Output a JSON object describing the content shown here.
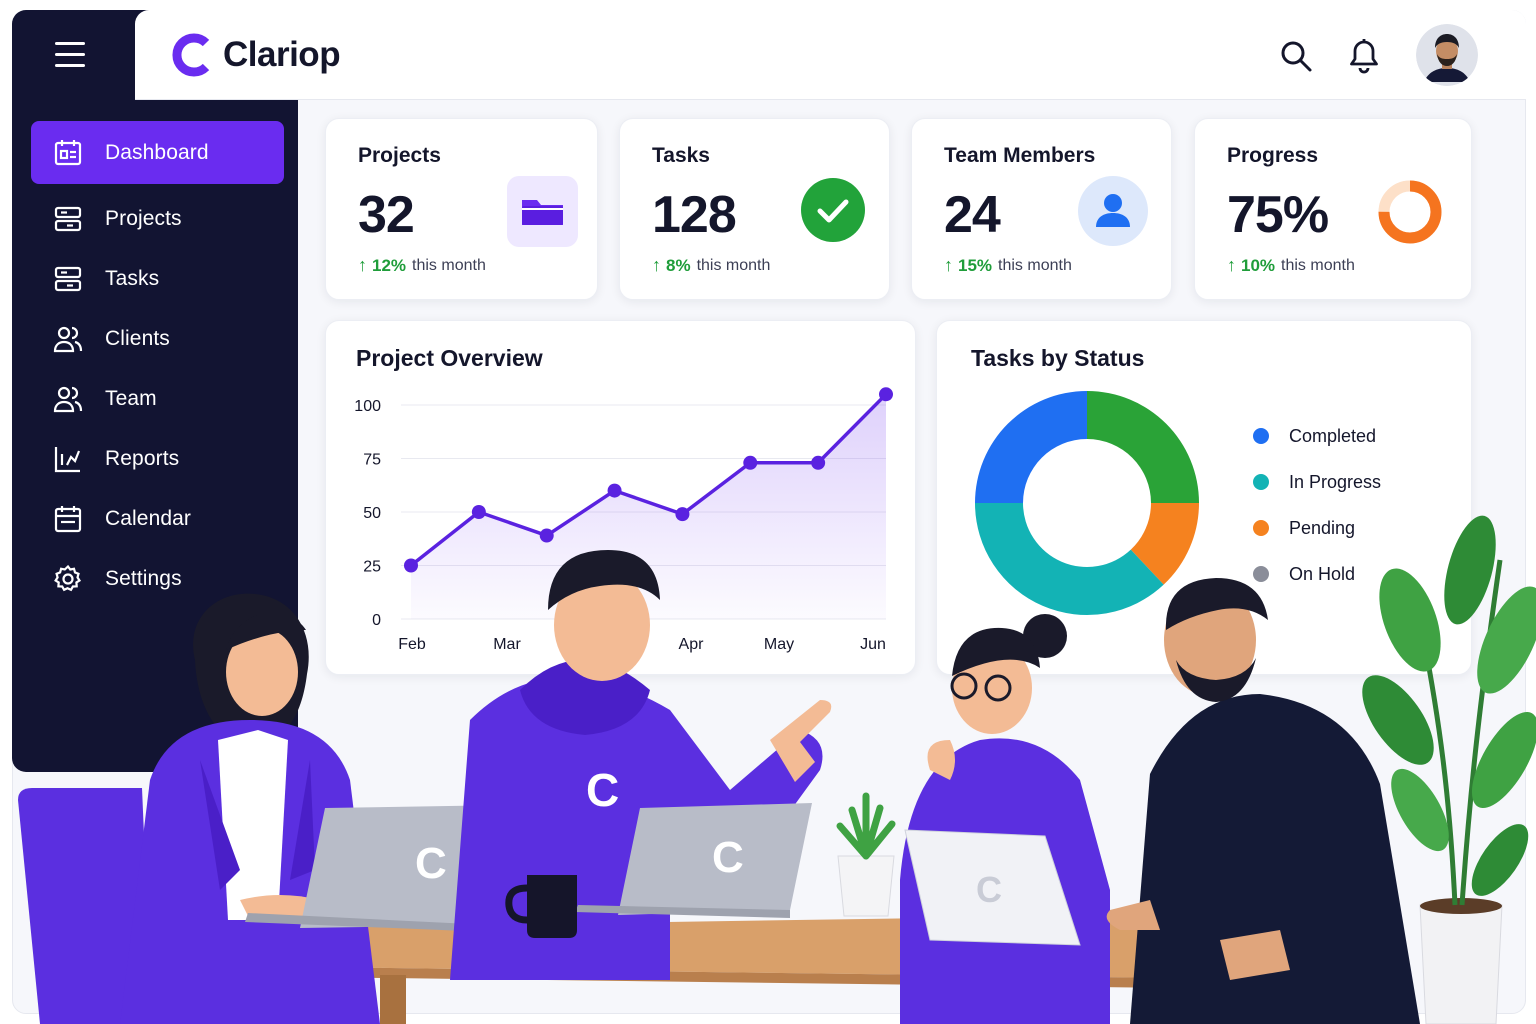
{
  "app": {
    "name": "Clariop"
  },
  "colors": {
    "accent": "#6a2cf0",
    "sidebar": "#121432",
    "positive": "#1f9d3a"
  },
  "header": {
    "icons": [
      "search-icon",
      "bell-icon"
    ],
    "avatar": "user-avatar"
  },
  "sidebar": {
    "items": [
      {
        "label": "Dashboard",
        "icon": "dashboard-icon",
        "active": true
      },
      {
        "label": "Projects",
        "icon": "projects-icon"
      },
      {
        "label": "Tasks",
        "icon": "tasks-icon"
      },
      {
        "label": "Clients",
        "icon": "clients-icon"
      },
      {
        "label": "Team",
        "icon": "team-icon"
      },
      {
        "label": "Reports",
        "icon": "reports-icon"
      },
      {
        "label": "Calendar",
        "icon": "calendar-icon"
      },
      {
        "label": "Settings",
        "icon": "settings-icon"
      }
    ]
  },
  "stats": [
    {
      "title": "Projects",
      "value": "32",
      "delta": "12%",
      "delta_label": "this month",
      "icon": "folder-icon"
    },
    {
      "title": "Tasks",
      "value": "128",
      "delta": "8%",
      "delta_label": "this month",
      "icon": "check-icon"
    },
    {
      "title": "Team Members",
      "value": "24",
      "delta": "15%",
      "delta_label": "this month",
      "icon": "user-icon"
    },
    {
      "title": "Progress",
      "value": "75%",
      "delta": "10%",
      "delta_label": "this month",
      "icon": "ring-progress-icon",
      "fraction": 0.75
    }
  ],
  "chart_data": [
    {
      "type": "area",
      "title": "Project Overview",
      "x": [
        "Feb",
        "",
        "Mar",
        "",
        "",
        "Apr",
        "",
        "May",
        "",
        "Jun"
      ],
      "x_ticks": [
        "Feb",
        "Mar",
        "Apr",
        "May",
        "Jun"
      ],
      "values": [
        25,
        50,
        39,
        60,
        49,
        73,
        73,
        105
      ],
      "ylim": [
        0,
        100
      ],
      "yticks": [
        0,
        25,
        50,
        75,
        100
      ],
      "grid": true
    },
    {
      "type": "pie",
      "title": "Tasks by Status",
      "categories": [
        "Completed",
        "In Progress",
        "Pending",
        "On Hold"
      ],
      "values": [
        25,
        37,
        13,
        25
      ],
      "colors": [
        "#1f6ff2",
        "#13b3b5",
        "#f5821f",
        "#2aa337"
      ],
      "legend_colors": [
        "#1f6ff2",
        "#13b3b5",
        "#f5821f",
        "#8a8d99"
      ],
      "legend": "right"
    }
  ]
}
